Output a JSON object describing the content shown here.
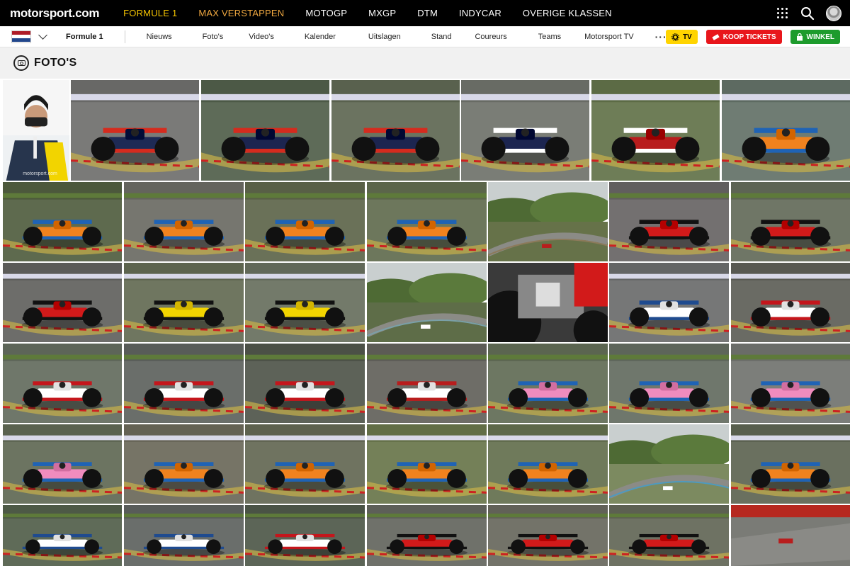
{
  "header": {
    "logo": "motorsport.com",
    "nav": [
      {
        "label": "FORMULE 1",
        "state": "active"
      },
      {
        "label": "MAX VERSTAPPEN",
        "state": "highlight"
      },
      {
        "label": "MOTOGP",
        "state": "normal"
      },
      {
        "label": "MXGP",
        "state": "normal"
      },
      {
        "label": "DTM",
        "state": "normal"
      },
      {
        "label": "INDYCAR",
        "state": "normal"
      },
      {
        "label": "OVERIGE KLASSEN",
        "state": "normal"
      }
    ],
    "icons": [
      "apps-grid-icon",
      "search-icon",
      "user-avatar"
    ]
  },
  "subnav": {
    "country_flag": "netherlands-flag-icon",
    "section": "Formule 1",
    "items": [
      "Nieuws",
      "Foto's",
      "Video's",
      "Kalender",
      "Uitslagen",
      "Stand",
      "Coureurs",
      "Teams",
      "Motorsport TV"
    ],
    "more": "···",
    "buttons": {
      "tv": "TV",
      "tickets": "KOOP TICKETS",
      "shop": "WINKEL"
    }
  },
  "page": {
    "title": "FOTO'S"
  },
  "colors": {
    "accent_yellow": "#f5c400",
    "tickets_red": "#e8161b",
    "shop_green": "#1d9b2c",
    "tv_yellow": "#ffd400"
  },
  "gallery": {
    "watermark": "motorsport.com",
    "rows": [
      [
        {
          "subject": "driver-portrait",
          "bg": "#27354d",
          "car": "#f2d400",
          "accent": "#111"
        },
        {
          "subject": "red-bull",
          "bg": "#7a7a78",
          "car": "#1e2a55",
          "accent": "#d52b1e"
        },
        {
          "subject": "red-bull-closeup",
          "bg": "#5e6b58",
          "car": "#1c2550",
          "accent": "#d52b1e"
        },
        {
          "subject": "red-bull",
          "bg": "#6b7360",
          "car": "#1c2550",
          "accent": "#d52b1e"
        },
        {
          "subject": "alphatauri-redbull",
          "bg": "#7a7d76",
          "car": "#1c2550",
          "accent": "#ffffff"
        },
        {
          "subject": "alfa-romeo",
          "bg": "#6e7d57",
          "car": "#b81d1d",
          "accent": "#ffffff"
        },
        {
          "subject": "mclaren",
          "bg": "#6f7c73",
          "car": "#f0821e",
          "accent": "#1f63b5"
        }
      ],
      [
        {
          "subject": "mclaren",
          "bg": "#5e6a4e",
          "car": "#f0821e",
          "accent": "#1f63b5"
        },
        {
          "subject": "mclaren",
          "bg": "#76766f",
          "car": "#f0821e",
          "accent": "#1f63b5"
        },
        {
          "subject": "mclaren",
          "bg": "#6a7158",
          "car": "#f0821e",
          "accent": "#1f63b5"
        },
        {
          "subject": "mclaren",
          "bg": "#6d775c",
          "car": "#f0821e",
          "accent": "#1f63b5"
        },
        {
          "subject": "landscape",
          "bg": "#667249",
          "car": "#b81d1d",
          "accent": "#8c7a5a"
        },
        {
          "subject": "ferrari",
          "bg": "#737070",
          "car": "#d21a1a",
          "accent": "#111111"
        },
        {
          "subject": "ferrari",
          "bg": "#6f7666",
          "car": "#d21a1a",
          "accent": "#111111"
        }
      ],
      [
        {
          "subject": "ferrari",
          "bg": "#6d6d6a",
          "car": "#d21a1a",
          "accent": "#111111"
        },
        {
          "subject": "renault",
          "bg": "#6f7660",
          "car": "#f2d400",
          "accent": "#111111"
        },
        {
          "subject": "renault",
          "bg": "#737a6a",
          "car": "#f2d400",
          "accent": "#111111"
        },
        {
          "subject": "landscape",
          "bg": "#5e6d48",
          "car": "#ffffff",
          "accent": "#7aa0a8"
        },
        {
          "subject": "haas-rear",
          "bg": "#3a3a3a",
          "car": "#d21a1a",
          "accent": "#888888"
        },
        {
          "subject": "williams",
          "bg": "#767777",
          "car": "#ffffff",
          "accent": "#1f4b8f"
        },
        {
          "subject": "haas",
          "bg": "#6a6b64",
          "car": "#ffffff",
          "accent": "#c4161c"
        }
      ],
      [
        {
          "subject": "haas",
          "bg": "#6f776a",
          "car": "#ffffff",
          "accent": "#c4161c"
        },
        {
          "subject": "haas",
          "bg": "#6a6e6a",
          "car": "#ffffff",
          "accent": "#c4161c"
        },
        {
          "subject": "haas-closeup",
          "bg": "#5d6258",
          "car": "#ffffff",
          "accent": "#c4161c"
        },
        {
          "subject": "alfa-romeo",
          "bg": "#6e6d67",
          "car": "#ffffff",
          "accent": "#b81d1d"
        },
        {
          "subject": "racing-point",
          "bg": "#6d7762",
          "car": "#f08cbe",
          "accent": "#1f63b5"
        },
        {
          "subject": "racing-point",
          "bg": "#6f776c",
          "car": "#f08cbe",
          "accent": "#1f63b5"
        },
        {
          "subject": "racing-point",
          "bg": "#7c7e7a",
          "car": "#f08cbe",
          "accent": "#1f63b5"
        }
      ],
      [
        {
          "subject": "racing-point",
          "bg": "#6c7461",
          "car": "#f08cbe",
          "accent": "#1f63b5"
        },
        {
          "subject": "mclaren",
          "bg": "#767466",
          "car": "#f0821e",
          "accent": "#1f63b5"
        },
        {
          "subject": "mclaren",
          "bg": "#6f7360",
          "car": "#f0821e",
          "accent": "#1f63b5"
        },
        {
          "subject": "mclaren",
          "bg": "#748058",
          "car": "#f0821e",
          "accent": "#1f63b5"
        },
        {
          "subject": "mclaren",
          "bg": "#6f7a5b",
          "car": "#f0821e",
          "accent": "#1f63b5"
        },
        {
          "subject": "landscape",
          "bg": "#7c8a60",
          "car": "#ffffff",
          "accent": "#4e9abf"
        },
        {
          "subject": "mclaren",
          "bg": "#6a705f",
          "car": "#f0821e",
          "accent": "#1f63b5"
        }
      ],
      [
        {
          "subject": "williams",
          "bg": "#5f6b58",
          "car": "#ffffff",
          "accent": "#1f4b8f"
        },
        {
          "subject": "williams",
          "bg": "#6a6e6b",
          "car": "#ffffff",
          "accent": "#1f4b8f"
        },
        {
          "subject": "haas",
          "bg": "#5c6557",
          "car": "#ffffff",
          "accent": "#c4161c"
        },
        {
          "subject": "ferrari",
          "bg": "#6f716a",
          "car": "#d21a1a",
          "accent": "#111111"
        },
        {
          "subject": "ferrari",
          "bg": "#737369",
          "car": "#d21a1a",
          "accent": "#111111"
        },
        {
          "subject": "ferrari",
          "bg": "#6e7263",
          "car": "#d21a1a",
          "accent": "#111111"
        },
        {
          "subject": "track",
          "bg": "#7a7b76",
          "car": "#b81d1d",
          "accent": "#c4161c"
        }
      ]
    ]
  }
}
